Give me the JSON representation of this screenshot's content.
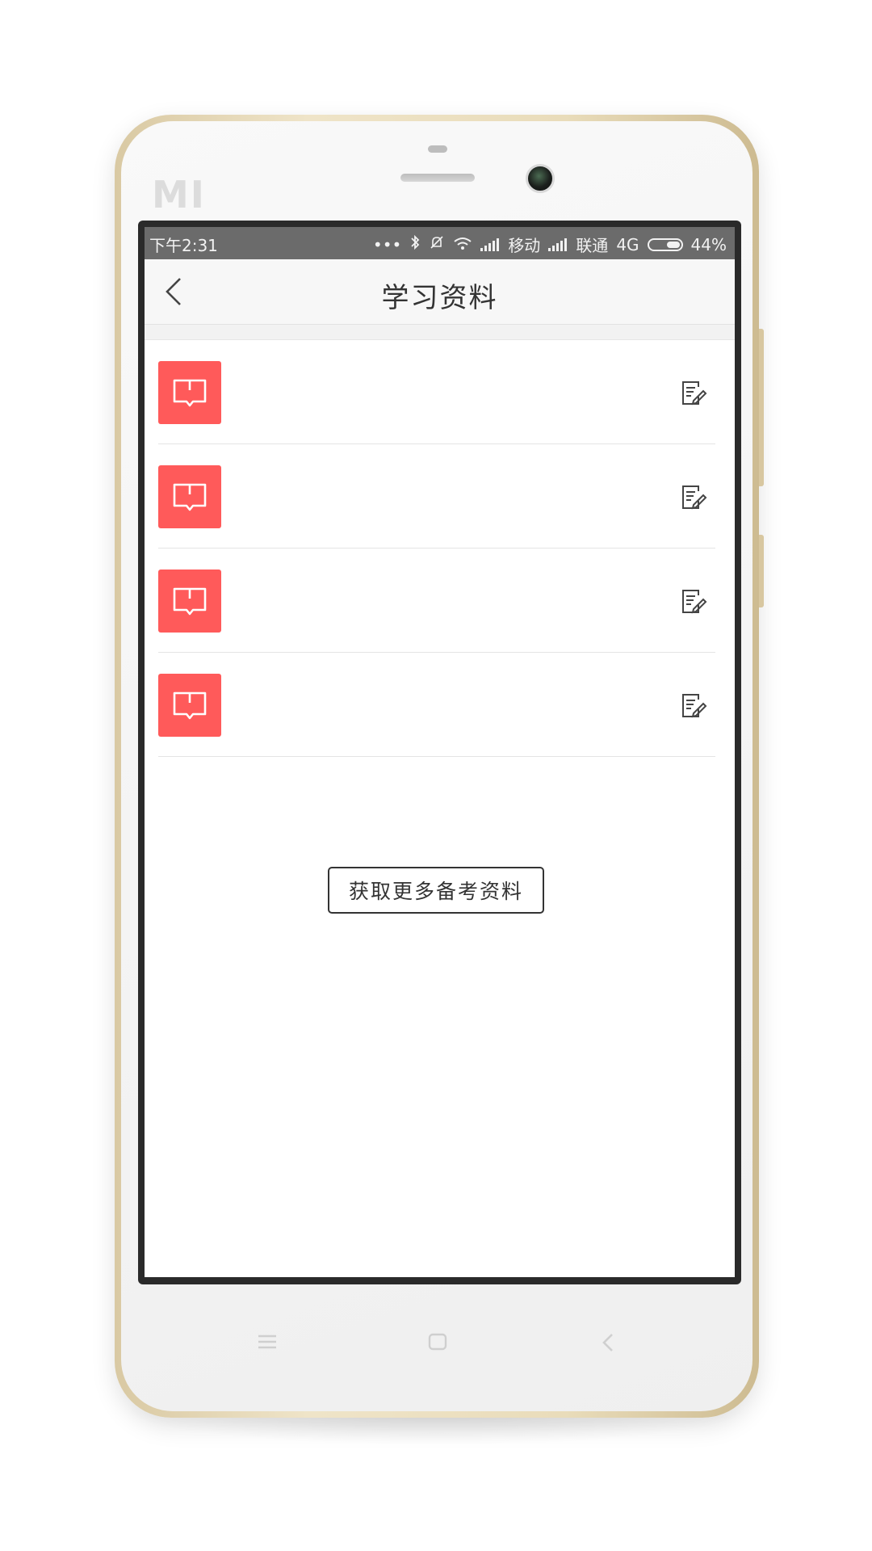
{
  "device": {
    "brand_logo": "MI"
  },
  "status_bar": {
    "time": "下午2:31",
    "carrier_1": "移动",
    "carrier_2": "联通",
    "network": "4G",
    "battery": "44%"
  },
  "nav": {
    "title": "学习资料"
  },
  "list": {
    "items": [
      {
        "icon": "book-icon",
        "action_icon": "edit-note-icon"
      },
      {
        "icon": "book-icon",
        "action_icon": "edit-note-icon"
      },
      {
        "icon": "book-icon",
        "action_icon": "edit-note-icon"
      },
      {
        "icon": "book-icon",
        "action_icon": "edit-note-icon"
      }
    ]
  },
  "actions": {
    "more_button_label": "获取更多备考资料"
  },
  "colors": {
    "accent": "#ff5a5a",
    "status_bar": "#6b6b6b",
    "nav_bg": "#f7f7f7"
  }
}
